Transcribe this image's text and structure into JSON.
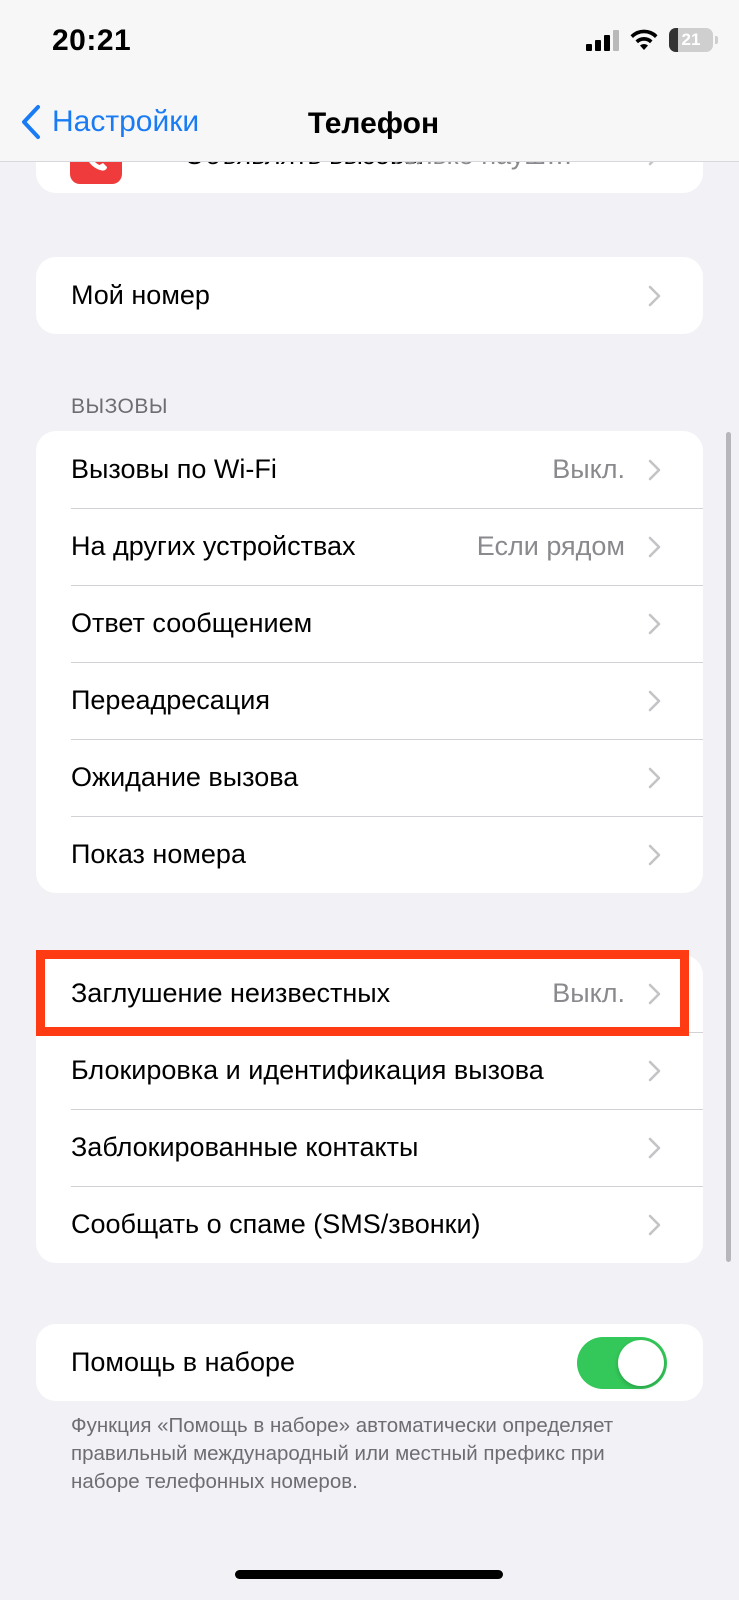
{
  "status_bar": {
    "time": "20:21",
    "battery_percent": "21",
    "icons": [
      "cellular-signal-icon",
      "wifi-icon",
      "battery-icon"
    ]
  },
  "nav": {
    "back_label": "Настройки",
    "title": "Телефон"
  },
  "top_partial_row": {
    "label": "Объявлять вызовы",
    "value": "Только науш…",
    "icon": "phone-icon",
    "icon_color": "#ef3b3b"
  },
  "my_number": {
    "label": "Мой номер"
  },
  "calls_section": {
    "header": "ВЫЗОВЫ",
    "rows": [
      {
        "label": "Вызовы по Wi-Fi",
        "value": "Выкл."
      },
      {
        "label": "На других устройствах",
        "value": "Если рядом"
      },
      {
        "label": "Ответ сообщением",
        "value": ""
      },
      {
        "label": "Переадресация",
        "value": ""
      },
      {
        "label": "Ожидание вызова",
        "value": ""
      },
      {
        "label": "Показ номера",
        "value": ""
      }
    ]
  },
  "blocking_section": {
    "rows": [
      {
        "label": "Заглушение неизвестных",
        "value": "Выкл."
      },
      {
        "label": "Блокировка и идентификация вызова",
        "value": ""
      },
      {
        "label": "Заблокированные контакты",
        "value": ""
      },
      {
        "label": "Сообщать о спаме (SMS/звонки)",
        "value": ""
      }
    ],
    "highlight_color": "#ff3b14"
  },
  "dial_assist": {
    "label": "Помощь в наборе",
    "enabled": true,
    "toggle_color": "#34c759",
    "footer": "Функция «Помощь в наборе» автоматически определяет правильный международный или местный префикс при наборе телефонных номеров."
  },
  "colors": {
    "accent": "#1a7cf5",
    "background": "#f2f2f6"
  }
}
